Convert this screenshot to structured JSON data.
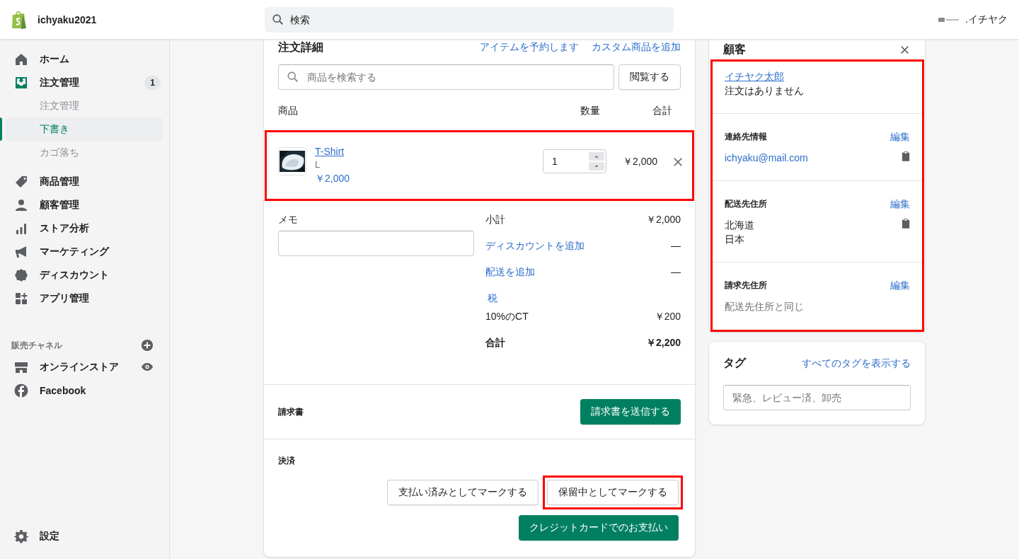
{
  "topbar": {
    "store_name": "ichyaku2021",
    "search": {
      "placeholder": "検索"
    },
    "account": {
      "name": ".イチヤク"
    }
  },
  "sidebar": {
    "nav": [
      {
        "label": "ホーム",
        "selected": false
      },
      {
        "label": "注文管理",
        "selected": false,
        "badge": "1",
        "children": [
          {
            "label": "注文管理",
            "selected": false
          },
          {
            "label": "下書き",
            "selected": true
          },
          {
            "label": "カゴ落ち",
            "selected": false
          }
        ]
      },
      {
        "label": "商品管理",
        "selected": false
      },
      {
        "label": "顧客管理",
        "selected": false
      },
      {
        "label": "ストア分析",
        "selected": false
      },
      {
        "label": "マーケティング",
        "selected": false
      },
      {
        "label": "ディスカウント",
        "selected": false
      },
      {
        "label": "アプリ管理",
        "selected": false
      }
    ],
    "channels_header": "販売チャネル",
    "channels": [
      {
        "label": "オンラインストア"
      },
      {
        "label": "Facebook"
      }
    ],
    "settings": "設定"
  },
  "order": {
    "title": "注文詳細",
    "actions": [
      "アイテムを予約します",
      "カスタム商品を追加"
    ],
    "search": {
      "placeholder": "商品を検索する"
    },
    "browse_button": "閲覧する",
    "columns": [
      "商品",
      "数量",
      "合計"
    ],
    "line_items": [
      {
        "name": "T-Shirt",
        "variant": "L",
        "price": "￥2,000",
        "quantity": "1",
        "total": "￥2,000",
        "highlighted": true
      }
    ],
    "note": {
      "label": "メモ"
    },
    "summary": [
      {
        "kind": "plain",
        "label": "小計",
        "value": "￥2,000"
      },
      {
        "kind": "link",
        "label": "ディスカウントを追加",
        "value": "—"
      },
      {
        "kind": "link",
        "label": "配送を追加",
        "value": "—"
      },
      {
        "kind": "link",
        "label": "税"
      },
      {
        "kind": "plain",
        "label": "10%のCT",
        "value": "￥200"
      },
      {
        "kind": "total",
        "label": "合計",
        "value": "￥2,200"
      }
    ],
    "invoice": {
      "label": "請求書",
      "button": "請求書を送信する"
    },
    "payment": {
      "label": "決済",
      "buttons": [
        {
          "label": "支払い済みとしてマークする",
          "kind": "secondary",
          "highlighted": false
        },
        {
          "label": "保留中としてマークする",
          "kind": "secondary",
          "highlighted": true
        },
        {
          "label": "クレジットカードでのお支払い",
          "kind": "primary",
          "highlighted": false
        }
      ]
    }
  },
  "customer": {
    "title": "顧客",
    "name": "イチヤク太郎",
    "orders_text": "注文はありません",
    "highlighted": true,
    "sections": [
      {
        "title": "連絡先情報",
        "edit": "編集",
        "copy": true,
        "lines": [
          {
            "kind": "link",
            "text": "ichyaku@mail.com"
          }
        ]
      },
      {
        "title": "配送先住所",
        "edit": "編集",
        "copy": true,
        "lines": [
          {
            "kind": "plain",
            "text": "北海道"
          },
          {
            "kind": "plain",
            "text": "日本"
          }
        ]
      },
      {
        "title": "請求先住所",
        "edit": "編集",
        "copy": false,
        "lines": [
          {
            "kind": "muted",
            "text": "配送先住所と同じ"
          }
        ]
      }
    ]
  },
  "tags": {
    "title": "タグ",
    "link": "すべてのタグを表示する",
    "placeholder": "緊急、レビュー済、卸売"
  }
}
